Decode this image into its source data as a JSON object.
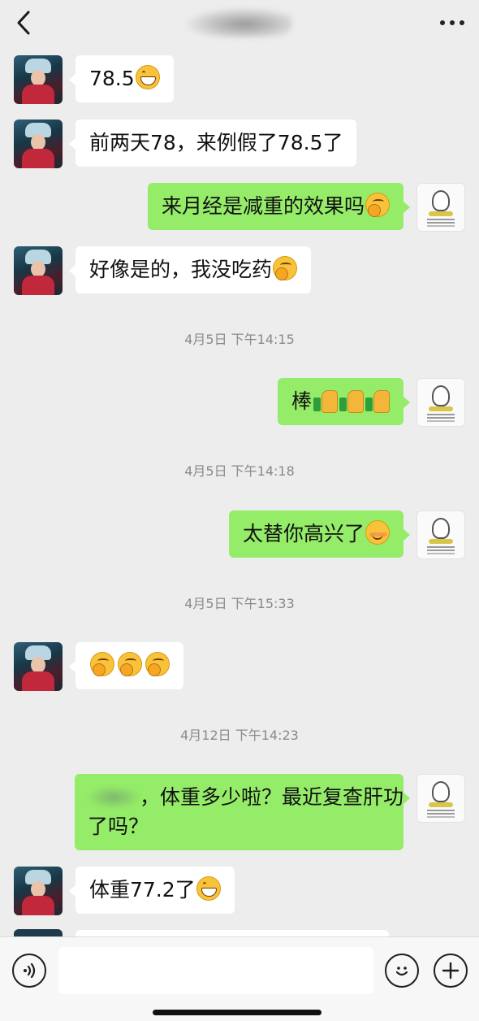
{
  "header": {
    "back_icon": "chevron-left-icon",
    "more_icon": "more-dots-icon"
  },
  "messages": [
    {
      "side": "left",
      "text": "78.5",
      "emoji": [
        "grin"
      ]
    },
    {
      "side": "left",
      "text": "前两天78，来例假了78.5了",
      "emoji": []
    },
    {
      "side": "right",
      "text": "来月经是减重的效果吗",
      "emoji": [
        "shy"
      ]
    },
    {
      "side": "left",
      "text": "好像是的，我没吃药",
      "emoji": [
        "shy"
      ]
    },
    {
      "timestamp": "4月5日 下午14:15"
    },
    {
      "side": "right",
      "text": "棒",
      "emoji": [
        "thumbs-up",
        "thumbs-up",
        "thumbs-up"
      ]
    },
    {
      "timestamp": "4月5日 下午14:18"
    },
    {
      "side": "right",
      "text": "太替你高兴了",
      "emoji": [
        "smile"
      ]
    },
    {
      "timestamp": "4月5日 下午15:33"
    },
    {
      "side": "left",
      "text": "",
      "emoji": [
        "shy",
        "shy",
        "shy"
      ]
    },
    {
      "timestamp": "4月12日 下午14:23"
    },
    {
      "side": "right",
      "text_line1": "，体重多少啦？最近复查肝功",
      "text_line2": "了吗？",
      "emoji": []
    },
    {
      "side": "left",
      "text": "体重77.2了",
      "emoji": [
        "grin"
      ]
    }
  ],
  "input_bar": {
    "voice_icon": "voice-icon",
    "emoji_icon": "emoji-icon",
    "plus_icon": "plus-icon",
    "input_value": ""
  },
  "colors": {
    "background": "#ededed",
    "sent_bubble": "#95ec69",
    "received_bubble": "#ffffff",
    "timestamp_text": "#8a8a8a"
  }
}
